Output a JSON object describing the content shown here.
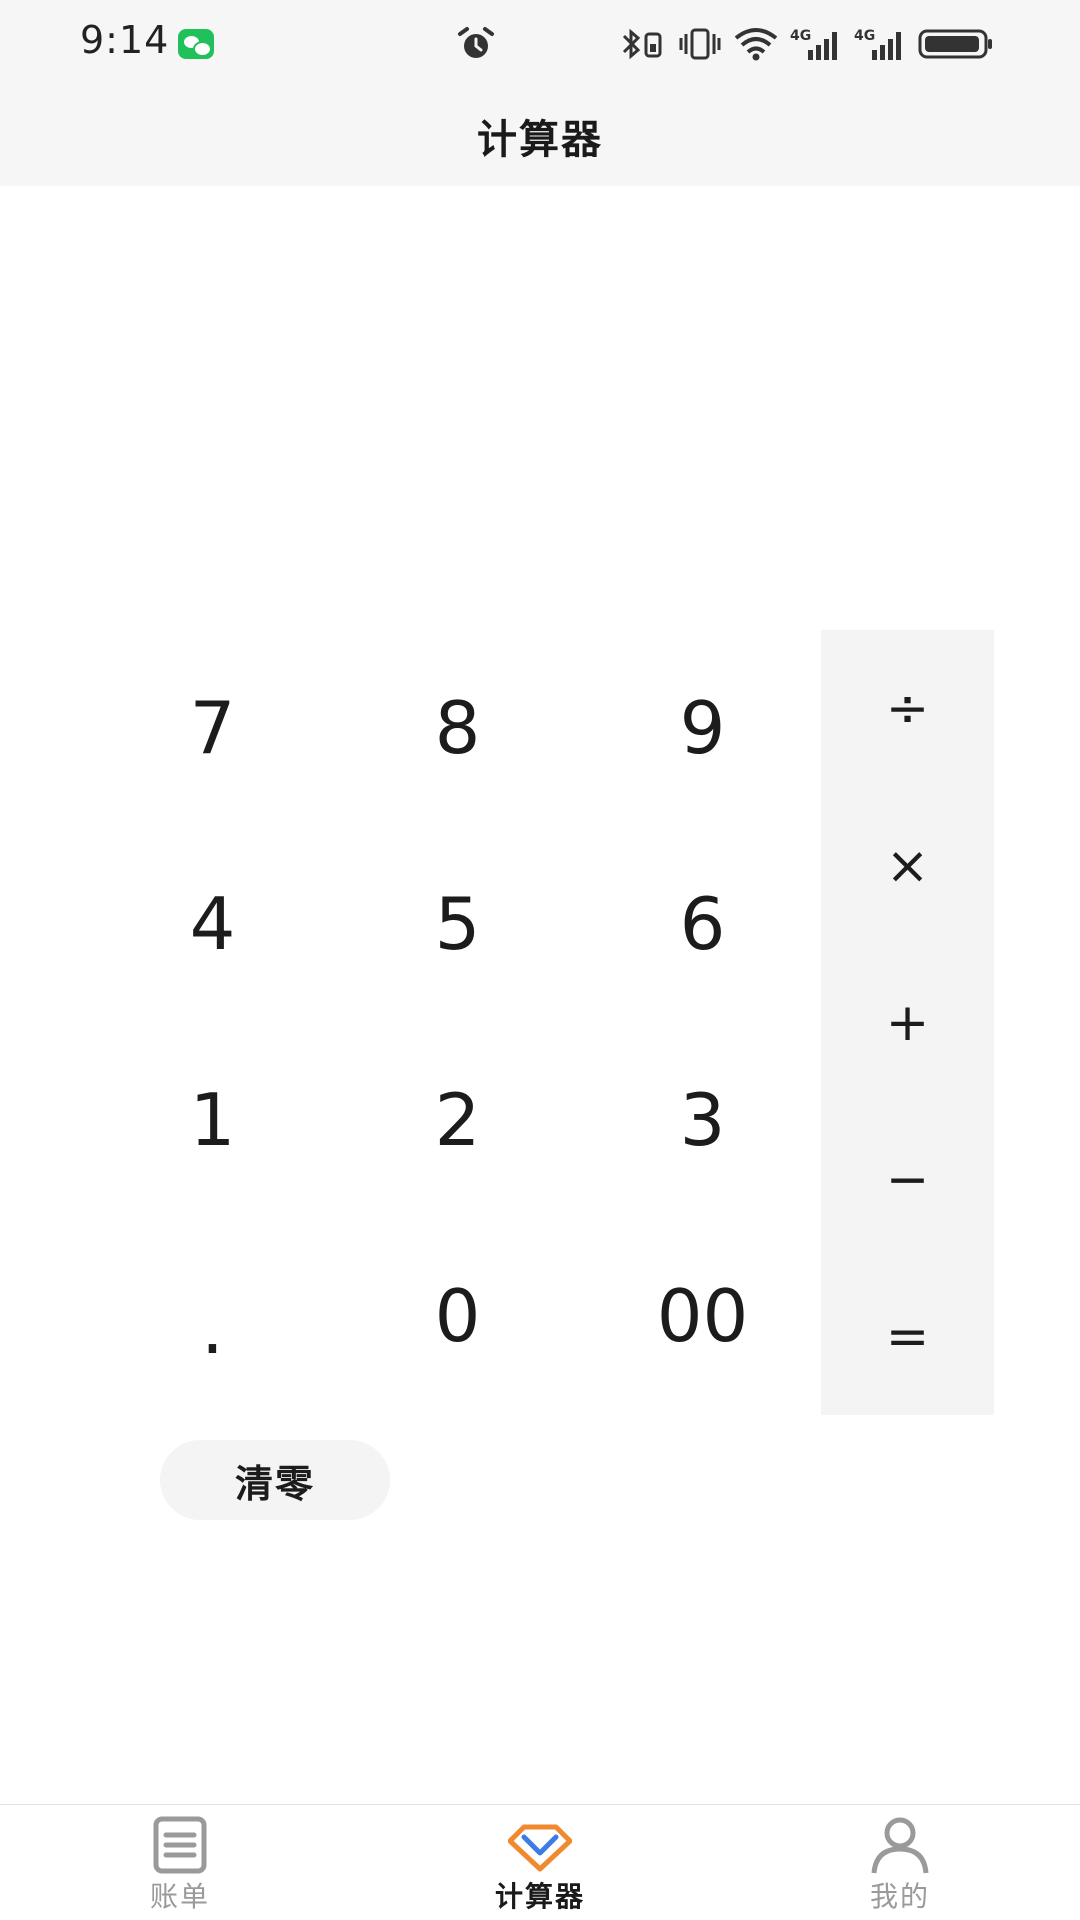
{
  "status_bar": {
    "time": "9:14",
    "icons": [
      "wechat-icon",
      "alarm-icon",
      "bluetooth-icon",
      "vibrate-icon",
      "wifi-icon",
      "signal-4g-icon",
      "signal-4g-icon",
      "battery-icon"
    ],
    "network_labels": [
      "4G",
      "4G"
    ]
  },
  "header": {
    "title": "计算器"
  },
  "keypad": {
    "digits": [
      "7",
      "8",
      "9",
      "4",
      "5",
      "6",
      "1",
      "2",
      "3",
      ".",
      "0",
      "00"
    ],
    "operators": [
      "÷",
      "×",
      "+",
      "−",
      "="
    ],
    "clear_label": "清零"
  },
  "tab_bar": {
    "tabs": [
      {
        "label": "账单",
        "icon": "bill-list-icon",
        "active": false
      },
      {
        "label": "计算器",
        "icon": "calculator-diamond-icon",
        "active": true
      },
      {
        "label": "我的",
        "icon": "profile-icon",
        "active": false
      }
    ]
  },
  "colors": {
    "status_bg": "#f6f6f6",
    "operator_bg": "#f4f4f4",
    "accent_orange": "#f08a2e",
    "accent_blue": "#3d7be6",
    "inactive_tab": "#9a9a9a"
  }
}
